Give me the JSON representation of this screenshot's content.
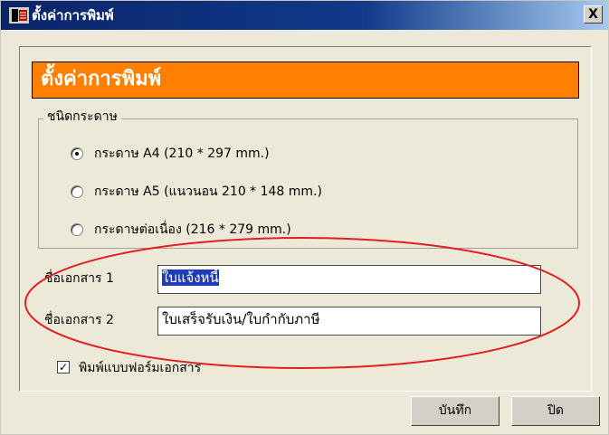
{
  "window": {
    "title": "ตั้งค่าการพิมพ์",
    "close_label": "X"
  },
  "header": {
    "title": "ตั้งค่าการพิมพ์",
    "color": "#ff7f00"
  },
  "paper_group": {
    "legend": "ชนิดกระดาษ",
    "options": [
      {
        "label": "กระดาษ A4 (210 * 297 mm.)",
        "selected": true
      },
      {
        "label": "กระดาษ A5 (แนวนอน 210 * 148 mm.)",
        "selected": false
      },
      {
        "label": "กระดาษต่อเนื่อง (216 * 279 mm.)",
        "selected": false
      }
    ]
  },
  "fields": [
    {
      "label": "ชื่อเอกสาร 1",
      "value": "ใบแจ้งหนี้"
    },
    {
      "label": "ชื่อเอกสาร 2",
      "value": "ใบเสร็จรับเงิน/ใบกำกับภาษี"
    }
  ],
  "print_form": {
    "label": "พิมพ์แบบฟอร์มเอกสาร",
    "checked": true
  },
  "buttons": {
    "save": "บันทึก",
    "close": "ปิด"
  },
  "annotation_color": "#e02020"
}
